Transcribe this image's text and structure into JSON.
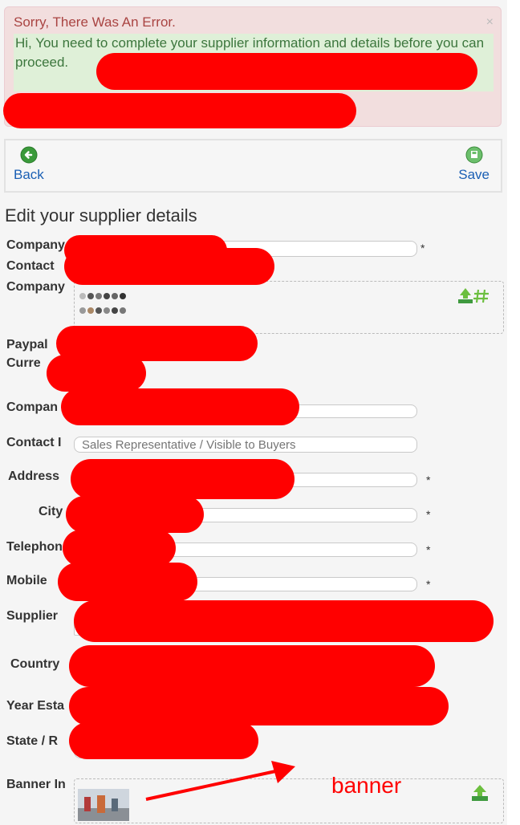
{
  "alert": {
    "title": "Sorry, There Was An Error.",
    "close": "×",
    "message": "Hi, You need to complete your supplier information and details before you can proceed."
  },
  "toolbar": {
    "back_label": "Back",
    "save_label": "Save"
  },
  "page_title": "Edit your supplier details",
  "form": {
    "company_name_label": "Company",
    "contact_label": "Contact",
    "company_logo_label": "Company",
    "paypal_label": "Paypal",
    "currency_label": "Curre",
    "company2_label": "Compan",
    "contact_title_label": "Contact I",
    "contact_title_placeholder": "Sales Representative / Visible to Buyers",
    "address_label": "Address",
    "city_label": "City",
    "telephone_label": "Telephon",
    "mobile_label": "Mobile",
    "supplier_label": "Supplier",
    "country_label": "Country",
    "year_label": "Year Esta",
    "state_label": "State / R",
    "banner_label": "Banner In",
    "required_mark": "*"
  },
  "annotation": {
    "banner_text": "banner"
  },
  "colors": {
    "alert_bg": "#f2dede",
    "alert_title": "#a94442",
    "success_bg": "#dff0d8",
    "success_text": "#3c763d",
    "link": "#1a5fb4",
    "redaction": "#ff0000"
  }
}
